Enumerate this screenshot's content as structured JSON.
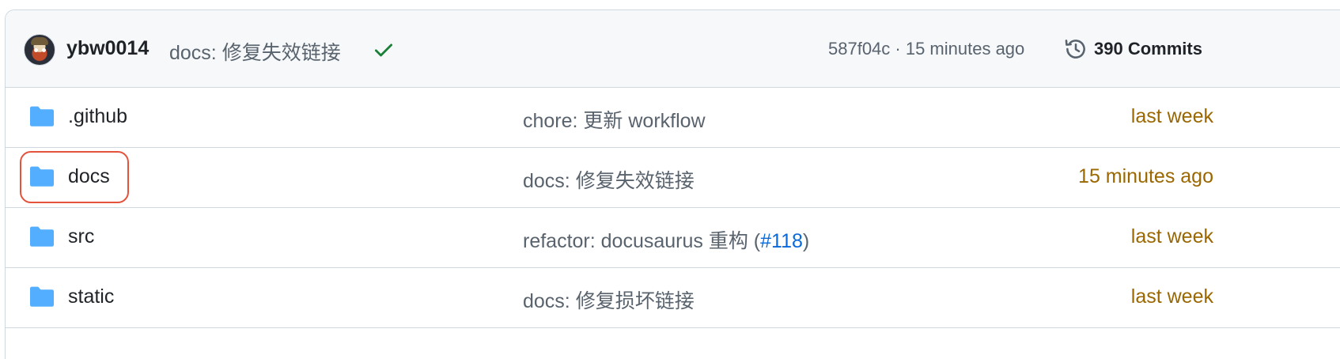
{
  "latest_commit": {
    "author": "ybw0014",
    "message": "docs: 修复失效链接",
    "sha_time": "587f04c · 15 minutes ago",
    "commits_label": "390 Commits"
  },
  "rows": [
    {
      "name": ".github",
      "message": "chore: 更新 workflow",
      "message_pr": "",
      "message_suffix": "",
      "age": "last week"
    },
    {
      "name": "docs",
      "message": "docs: 修复失效链接",
      "message_pr": "",
      "message_suffix": "",
      "age": "15 minutes ago"
    },
    {
      "name": "src",
      "message": "refactor: docusaurus 重构 (",
      "message_pr": "#118",
      "message_suffix": ")",
      "age": "last week"
    },
    {
      "name": "static",
      "message": "docs: 修复损坏链接",
      "message_pr": "",
      "message_suffix": "",
      "age": "last week"
    }
  ],
  "colors": {
    "folder": "#54aeff",
    "age": "#9a6700",
    "link": "#0969da",
    "check": "#1a7f37",
    "highlight": "#e5533d"
  },
  "icons": {
    "folder": "folder-icon",
    "check": "check-icon",
    "history": "history-icon",
    "avatar": "avatar"
  }
}
